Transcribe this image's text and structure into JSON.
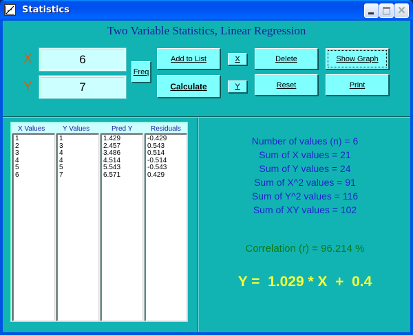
{
  "window": {
    "title": "Statistics"
  },
  "header": {
    "title": "Two Variable Statistics, Linear Regression"
  },
  "inputs": {
    "x_label": "X",
    "y_label": "Y",
    "x_value": "6",
    "y_value": "7"
  },
  "buttons": {
    "freq": "Freq",
    "add_to_list": "Add to List",
    "calculate": "Calculate",
    "x_small": "X",
    "y_small": "Y",
    "delete": "Delete",
    "reset": "Reset",
    "show_graph": "Show Graph",
    "print": "Print"
  },
  "table": {
    "headers": [
      "X Values",
      "Y Values",
      "Pred Y",
      "Residuals"
    ],
    "x_values": [
      "1",
      "2",
      "3",
      "4",
      "5",
      "6"
    ],
    "y_values": [
      "1",
      "3",
      "4",
      "4",
      "5",
      "7"
    ],
    "pred_y": [
      "1.429",
      "2.457",
      "3.486",
      "4.514",
      "5.543",
      "6.571"
    ],
    "residuals": [
      "-0.429",
      "0.543",
      "0.514",
      "-0.514",
      "-0.543",
      "0.429"
    ]
  },
  "stats": {
    "n": "Number of values (n) = 6",
    "sum_x": "Sum of X values = 21",
    "sum_y": "Sum of Y values = 24",
    "sum_x2": "Sum of X^2 values = 91",
    "sum_y2": "Sum of Y^2 values = 116",
    "sum_xy": "Sum of XY values = 102",
    "correlation": "Correlation (r) = 96.214 %",
    "equation": "Y =  1.029 * X  +  0.4"
  },
  "colors": {
    "client_bg": "#12b4b3",
    "button_bg": "#80ffff",
    "heading": "#1c1c9e",
    "correlation": "#0c7a10",
    "equation": "#ffff33",
    "axis_label": "#d06010"
  },
  "icons": {
    "app": "graph-icon",
    "minimize": "minimize-icon",
    "maximize": "maximize-icon",
    "close": "close-icon"
  }
}
